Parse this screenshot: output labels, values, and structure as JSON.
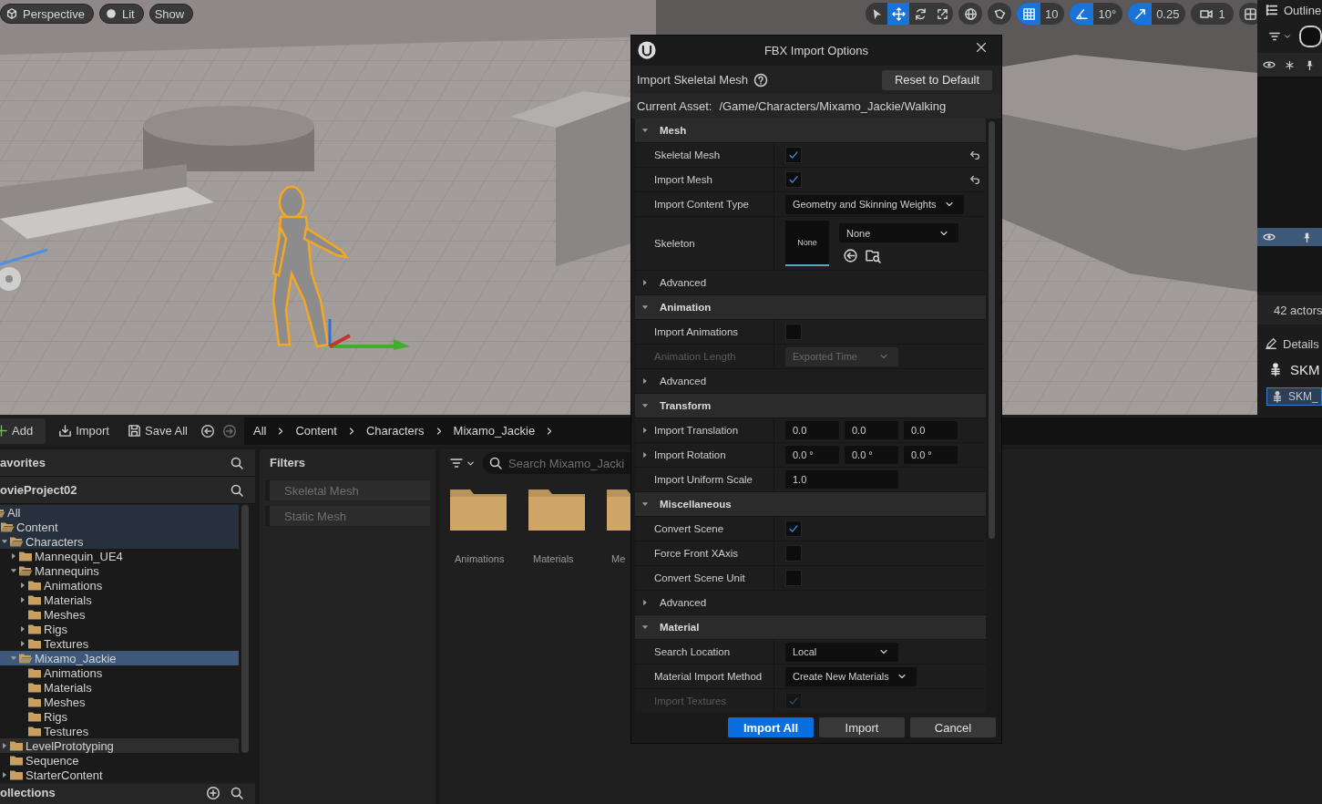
{
  "viewport": {
    "view_buttons": [
      {
        "label": "Perspective",
        "kind": "perspective"
      },
      {
        "label": "Lit",
        "kind": "lighting"
      },
      {
        "label": "Show",
        "kind": "plain"
      }
    ],
    "transform_tools": [
      {
        "selected": false
      },
      {
        "selected": true
      },
      {
        "selected": false
      },
      {
        "selected": false
      }
    ],
    "snaps": [
      {
        "kind": "grid",
        "on": true,
        "value": "10"
      },
      {
        "kind": "angle",
        "on": true,
        "value": "10°"
      },
      {
        "kind": "scale",
        "on": true,
        "value": "0.25"
      }
    ],
    "camera_speed": "1"
  },
  "outliner": {
    "title": "Outline",
    "rows": [
      {
        "selected": true
      }
    ],
    "status": "42 actors"
  },
  "details": {
    "title": "Details",
    "object": "SKM",
    "components": [
      {
        "label": "SKM_",
        "selected": true
      }
    ]
  },
  "browser": {
    "toolbar": [
      {
        "label": "Add",
        "kind": "add"
      },
      {
        "label": "Import",
        "kind": "import"
      },
      {
        "label": "Save All",
        "kind": "save"
      }
    ],
    "breadcrumb": [
      "All",
      "Content",
      "Characters",
      "Mixamo_Jackie"
    ],
    "favorites": "avorites",
    "project": "ovieProject02",
    "collections": "ollections",
    "tree": [
      {
        "label": "All",
        "expanded": true,
        "selected": false,
        "pinned": true,
        "hovered": false,
        "children": [
          {
            "label": "Content",
            "expanded": true,
            "selected": false,
            "pinned": true,
            "hovered": false,
            "children": [
              {
                "label": "Characters",
                "expanded": true,
                "expandable": true,
                "selected": false,
                "pinned": true,
                "hovered": false,
                "children": [
                  {
                    "label": "Mannequin_UE4",
                    "expanded": false,
                    "expandable": true,
                    "selected": false,
                    "pinned": false,
                    "hovered": false
                  },
                  {
                    "label": "Mannequins",
                    "expanded": true,
                    "expandable": true,
                    "selected": false,
                    "pinned": false,
                    "hovered": false,
                    "children": [
                      {
                        "label": "Animations",
                        "expanded": false,
                        "expandable": true,
                        "selected": false,
                        "pinned": false,
                        "hovered": false
                      },
                      {
                        "label": "Materials",
                        "expanded": false,
                        "expandable": true,
                        "selected": false,
                        "pinned": false,
                        "hovered": false
                      },
                      {
                        "label": "Meshes",
                        "expanded": false,
                        "expandable": false,
                        "selected": false,
                        "pinned": false,
                        "hovered": false
                      },
                      {
                        "label": "Rigs",
                        "expanded": false,
                        "expandable": true,
                        "selected": false,
                        "pinned": false,
                        "hovered": false
                      },
                      {
                        "label": "Textures",
                        "expanded": false,
                        "expandable": true,
                        "selected": false,
                        "pinned": false,
                        "hovered": false
                      }
                    ]
                  },
                  {
                    "label": "Mixamo_Jackie",
                    "expanded": true,
                    "expandable": true,
                    "selected": true,
                    "pinned": false,
                    "hovered": false,
                    "children": [
                      {
                        "label": "Animations",
                        "expanded": false,
                        "expandable": false,
                        "selected": false,
                        "pinned": false,
                        "hovered": false
                      },
                      {
                        "label": "Materials",
                        "expanded": false,
                        "expandable": false,
                        "selected": false,
                        "pinned": false,
                        "hovered": false
                      },
                      {
                        "label": "Meshes",
                        "expanded": false,
                        "expandable": false,
                        "selected": false,
                        "pinned": false,
                        "hovered": false
                      },
                      {
                        "label": "Rigs",
                        "expanded": false,
                        "expandable": false,
                        "selected": false,
                        "pinned": false,
                        "hovered": false
                      },
                      {
                        "label": "Testures",
                        "expanded": false,
                        "expandable": false,
                        "selected": false,
                        "pinned": false,
                        "hovered": false
                      }
                    ]
                  }
                ]
              },
              {
                "label": "LevelPrototyping",
                "expanded": false,
                "expandable": true,
                "selected": false,
                "pinned": false,
                "hovered": true
              },
              {
                "label": "Sequence",
                "expanded": false,
                "expandable": false,
                "selected": false,
                "pinned": false,
                "hovered": false
              },
              {
                "label": "StarterContent",
                "expanded": false,
                "expandable": true,
                "selected": false,
                "pinned": false,
                "hovered": false
              }
            ]
          }
        ]
      }
    ],
    "filters_title": "Filters",
    "filters": [
      {
        "label": "Skeletal Mesh",
        "active": false
      },
      {
        "label": "Static Mesh",
        "active": false
      }
    ],
    "search": {
      "placeholder": "Search Mixamo_Jacki"
    },
    "assets": [
      {
        "label": "Animations"
      },
      {
        "label": "Materials"
      },
      {
        "label": "Me"
      }
    ]
  },
  "dialog": {
    "title": "FBX Import Options",
    "subtitle": "Import Skeletal Mesh",
    "reset_label": "Reset to Default",
    "asset_label": "Current Asset:",
    "asset_path": "/Game/Characters/Mixamo_Jackie/Walking",
    "sections": [
      {
        "title": "Mesh",
        "expanded": true,
        "rows": [
          {
            "kind": "checkbox",
            "label": "Skeletal Mesh",
            "checked": true,
            "disabled": false,
            "resettable": true
          },
          {
            "kind": "checkbox",
            "label": "Import Mesh",
            "checked": true,
            "disabled": false,
            "resettable": true
          },
          {
            "kind": "dropdown",
            "label": "Import Content Type",
            "value": "Geometry and Skinning Weights",
            "disabled": false
          },
          {
            "kind": "skeleton",
            "label": "Skeleton",
            "thumb": "None",
            "value": "None",
            "disabled": false
          },
          {
            "kind": "group",
            "label": "Advanced",
            "expanded": false
          }
        ]
      },
      {
        "title": "Animation",
        "expanded": true,
        "rows": [
          {
            "kind": "checkbox",
            "label": "Import Animations",
            "checked": false,
            "disabled": false,
            "resettable": false
          },
          {
            "kind": "dropdown",
            "label": "Animation Length",
            "value": "Exported Time",
            "disabled": true
          },
          {
            "kind": "group",
            "label": "Advanced",
            "expanded": false
          }
        ]
      },
      {
        "title": "Transform",
        "expanded": true,
        "rows": [
          {
            "kind": "vector",
            "label": "Import Translation",
            "expanded": false,
            "values": [
              "0.0",
              "0.0",
              "0.0"
            ],
            "disabled": false
          },
          {
            "kind": "vector",
            "label": "Import Rotation",
            "expanded": false,
            "values": [
              "0.0 °",
              "0.0 °",
              "0.0 °"
            ],
            "disabled": false
          },
          {
            "kind": "number",
            "label": "Import Uniform Scale",
            "value": "1.0",
            "disabled": false
          }
        ]
      },
      {
        "title": "Miscellaneous",
        "expanded": true,
        "rows": [
          {
            "kind": "checkbox",
            "label": "Convert Scene",
            "checked": true,
            "disabled": false,
            "resettable": false
          },
          {
            "kind": "checkbox",
            "label": "Force Front XAxis",
            "checked": false,
            "disabled": false,
            "resettable": false
          },
          {
            "kind": "checkbox",
            "label": "Convert Scene Unit",
            "checked": false,
            "disabled": false,
            "resettable": false
          },
          {
            "kind": "group",
            "label": "Advanced",
            "expanded": false
          }
        ]
      },
      {
        "title": "Material",
        "expanded": true,
        "rows": [
          {
            "kind": "dropdown",
            "label": "Search Location",
            "value": "Local",
            "disabled": false
          },
          {
            "kind": "dropdown",
            "label": "Material Import Method",
            "value": "Create New Materials",
            "disabled": false
          },
          {
            "kind": "checkbox",
            "label": "Import Textures",
            "checked": true,
            "disabled": true,
            "resettable": false
          }
        ]
      }
    ],
    "buttons": [
      {
        "label": "Import All",
        "primary": true
      },
      {
        "label": "Import",
        "primary": false
      },
      {
        "label": "Cancel",
        "primary": false
      }
    ]
  }
}
